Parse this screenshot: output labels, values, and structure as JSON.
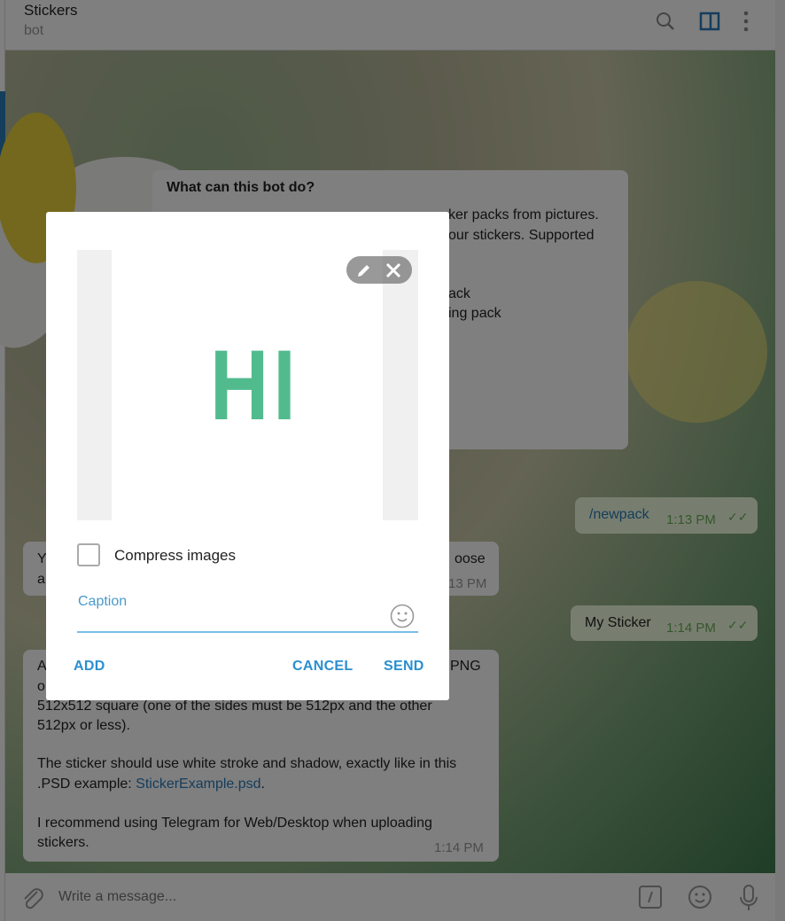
{
  "header": {
    "title": "Stickers",
    "subtitle": "bot",
    "icons": [
      "search-icon",
      "sidebar-toggle-icon",
      "more-vertical-icon"
    ]
  },
  "bot_info": {
    "title": "What can this bot do?",
    "visible_lines": [
      "ker packs from pictures.",
      "our stickers. Supported",
      "ack",
      "ing pack"
    ]
  },
  "messages": [
    {
      "type": "out",
      "text": "/newpack",
      "time": "1:13 PM",
      "status": "read"
    },
    {
      "type": "in",
      "visible_lines": [
        "Y",
        "oose",
        "a"
      ],
      "time": "13 PM"
    },
    {
      "type": "out",
      "text": "My Sticker",
      "time": "1:14 PM",
      "status": "read"
    },
    {
      "type": "in",
      "lines": [
        "A",
        "PNG",
        "o",
        "512x512 square (one of the sides must be 512px and the other",
        "512px or less).",
        "The sticker should use white stroke and shadow, exactly like in this",
        ".PSD example: ",
        "StickerExample.psd",
        ".",
        "I recommend using Telegram for Web/Desktop when uploading",
        "stickers."
      ],
      "time": "1:14 PM"
    }
  ],
  "composer": {
    "placeholder": "Write a message...",
    "icons": [
      "attach-icon",
      "bot-command-icon",
      "emoji-icon",
      "microphone-icon"
    ]
  },
  "modal": {
    "image_text": "HI",
    "image_color": "#52bb8e",
    "compress_label": "Compress images",
    "compress_checked": false,
    "caption_label": "Caption",
    "caption_value": "",
    "add": "ADD",
    "cancel": "CANCEL",
    "send": "SEND",
    "accent": "#2a8fd0"
  }
}
